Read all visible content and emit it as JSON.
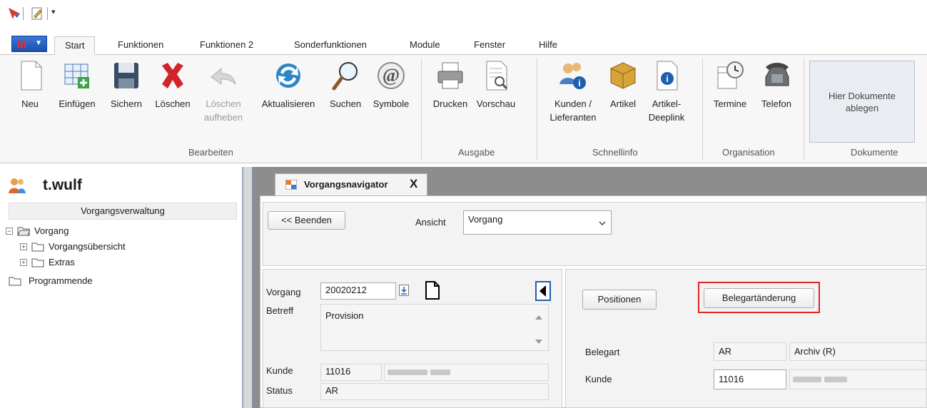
{
  "ribbon": {
    "app_button_letter": "M",
    "tabs": [
      "Start",
      "Funktionen",
      "Funktionen 2",
      "Sonderfunktionen",
      "Module",
      "Fenster",
      "Hilfe"
    ],
    "buttons": {
      "neu": "Neu",
      "einfuegen": "Einfügen",
      "sichern": "Sichern",
      "loeschen": "Löschen",
      "loeschen_aufheben_1": "Löschen",
      "loeschen_aufheben_2": "aufheben",
      "aktualisieren": "Aktualisieren",
      "suchen": "Suchen",
      "symbole": "Symbole",
      "drucken": "Drucken",
      "vorschau": "Vorschau",
      "kunden_1": "Kunden /",
      "kunden_2": "Lieferanten",
      "artikel": "Artikel",
      "artikel_deeplink_1": "Artikel-",
      "artikel_deeplink_2": "Deeplink",
      "termine": "Termine",
      "telefon": "Telefon"
    },
    "groups": {
      "bearbeiten": "Bearbeiten",
      "ausgabe": "Ausgabe",
      "schnellinfo": "Schnellinfo",
      "organisation": "Organisation",
      "dokumente": "Dokumente"
    },
    "dropzone_line1": "Hier Dokumente",
    "dropzone_line2": "ablegen"
  },
  "sidebar": {
    "user": "t.wulf",
    "header": "Vorgangsverwaltung",
    "tree": {
      "root": "Vorgang",
      "child1": "Vorgangsübersicht",
      "child2": "Extras",
      "programmende": "Programmende"
    }
  },
  "doc_tab": {
    "title": "Vorgangsnavigator",
    "close": "X"
  },
  "toolbar": {
    "beenden": "<< Beenden",
    "ansicht_label": "Ansicht",
    "ansicht_value": "Vorgang"
  },
  "vorgang_pane": {
    "vorgang_label": "Vorgang",
    "vorgang_value": "20020212",
    "betreff_label": "Betreff",
    "betreff_value": "Provision",
    "kunde_label": "Kunde",
    "kunde_value": "11016",
    "status_label": "Status",
    "status_value": "AR"
  },
  "detail_pane": {
    "positionen_button": "Positionen",
    "belegart_button": "Belegartänderung",
    "belegart_label": "Belegart",
    "belegart_code": "AR",
    "belegart_name": "Archiv (R)",
    "kunde_label": "Kunde",
    "kunde_value": "11016"
  },
  "colors": {
    "highlight": "#e22424",
    "app_button": "#2a63c4"
  }
}
